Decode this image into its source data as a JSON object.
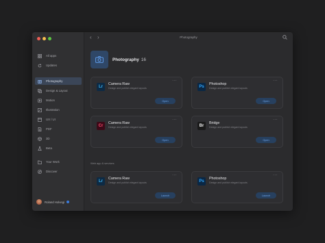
{
  "window": {
    "title": "Photography"
  },
  "colors": {
    "accent": "#3a7bdc",
    "active_bg": "#3b4658",
    "button_bg": "#27405f",
    "button_text": "#6fa7ee"
  },
  "sidebar": {
    "items": [
      {
        "label": "All apps",
        "icon": "grid-icon"
      },
      {
        "label": "Updates",
        "icon": "refresh-icon"
      },
      {
        "label": "Photography",
        "icon": "camera-icon"
      },
      {
        "label": "Design & Layout",
        "icon": "layers-icon"
      },
      {
        "label": "Motion",
        "icon": "film-icon"
      },
      {
        "label": "Illustration",
        "icon": "pen-icon"
      },
      {
        "label": "UX / UI",
        "icon": "ux-icon"
      },
      {
        "label": "PDF",
        "icon": "pdf-icon"
      },
      {
        "label": "3D",
        "icon": "cube-icon"
      },
      {
        "label": "Beta",
        "icon": "flask-icon"
      },
      {
        "label": "Your Work",
        "icon": "folder-icon"
      },
      {
        "label": "Discover",
        "icon": "compass-icon"
      }
    ],
    "user": {
      "name": "Roland Holvegi"
    }
  },
  "header": {
    "title": "Photography",
    "count": "16"
  },
  "cards": [
    {
      "abbr": "Lr",
      "name": "Camera Raw",
      "desc": "Design and publish elegant layouts",
      "button": "Open"
    },
    {
      "abbr": "Ps",
      "name": "Photoshop",
      "desc": "Design and publish elegant layouts",
      "button": "Open"
    },
    {
      "abbr": "Cr",
      "name": "Camera Raw",
      "desc": "Design and publish elegant layouts",
      "button": "Open"
    },
    {
      "abbr": "Br",
      "name": "Bridge",
      "desc": "Design and publish elegant layouts",
      "button": "Open"
    }
  ],
  "web_section": {
    "label": "Web app & services"
  },
  "web_cards": [
    {
      "abbr": "Lr",
      "name": "Camera Raw",
      "desc": "Design and publish elegant layouts",
      "button": "Launch"
    },
    {
      "abbr": "Ps",
      "name": "Photoshop",
      "desc": "Design and publish elegant layouts",
      "button": "Launch"
    }
  ]
}
